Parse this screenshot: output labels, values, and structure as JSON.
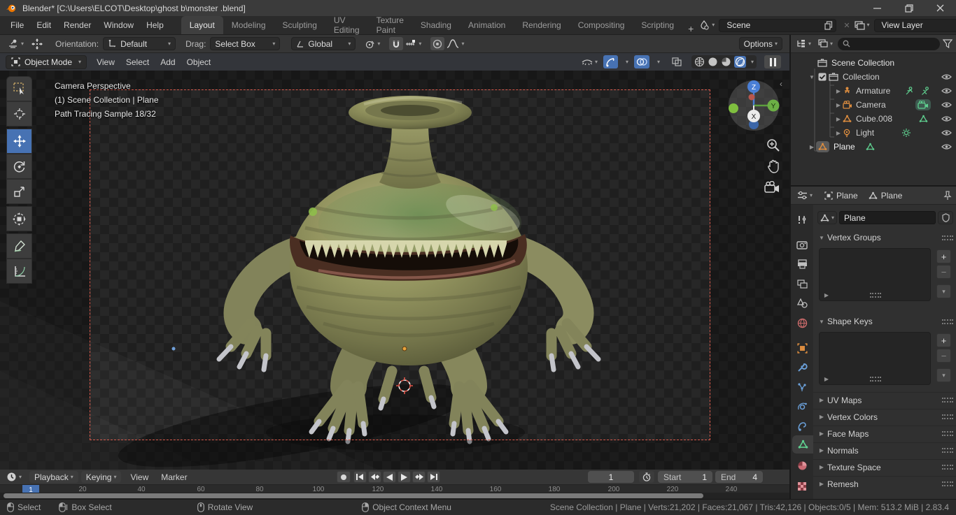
{
  "window": {
    "title": "Blender* [C:\\Users\\ELCOT\\Desktop\\ghost b\\monster .blend]"
  },
  "topbar": {
    "menus": [
      "File",
      "Edit",
      "Render",
      "Window",
      "Help"
    ],
    "workspaces": [
      "Layout",
      "Modeling",
      "Sculpting",
      "UV Editing",
      "Texture Paint",
      "Shading",
      "Animation",
      "Rendering",
      "Compositing",
      "Scripting"
    ],
    "add_tab": "+",
    "scene_label": "Scene",
    "view_layer_label": "View Layer"
  },
  "tool_settings": {
    "orientation_label": "Orientation:",
    "orientation_value": "Default",
    "drag_label": "Drag:",
    "drag_value": "Select Box",
    "pivot_value": "Global",
    "options": "Options"
  },
  "viewport_header": {
    "mode": "Object Mode",
    "menus": [
      "View",
      "Select",
      "Add",
      "Object"
    ]
  },
  "viewport": {
    "overlay_line1": "Camera Perspective",
    "overlay_line2": "(1) Scene Collection | Plane",
    "overlay_line3": "Path Tracing Sample 18/32",
    "axis_x": "X",
    "axis_y": "Y",
    "axis_z": "Z"
  },
  "outliner": {
    "rows": [
      {
        "label": "Scene Collection"
      },
      {
        "label": "Collection"
      },
      {
        "label": "Armature"
      },
      {
        "label": "Camera"
      },
      {
        "label": "Cube.008"
      },
      {
        "label": "Light"
      },
      {
        "label": "Plane"
      }
    ]
  },
  "properties": {
    "breadcrumb_object": "Plane",
    "breadcrumb_data": "Plane",
    "name_value": "Plane",
    "panels": {
      "vertex_groups": "Vertex Groups",
      "shape_keys": "Shape Keys",
      "uv_maps": "UV Maps",
      "vertex_colors": "Vertex Colors",
      "face_maps": "Face Maps",
      "normals": "Normals",
      "texture_space": "Texture Space",
      "remesh": "Remesh"
    }
  },
  "timeline": {
    "playback": "Playback",
    "keying": "Keying",
    "view": "View",
    "marker": "Marker",
    "marker_frame": "1",
    "current_frame": "1",
    "start_label": "Start",
    "start_value": "1",
    "end_label": "End",
    "end_value": "4",
    "ruler": [
      "20",
      "40",
      "60",
      "80",
      "100",
      "120",
      "140",
      "160",
      "180",
      "200",
      "220",
      "240"
    ]
  },
  "statusbar": {
    "hint_select": "Select",
    "hint_box_select": "Box Select",
    "hint_rotate": "Rotate View",
    "hint_context": "Object Context Menu",
    "stats": "Scene Collection | Plane | Verts:21,202 | Faces:21,067 | Tris:42,126 | Objects:0/5 | Mem: 513.2 MiB | 2.83.4"
  },
  "colors": {
    "accent_blue": "#4772b3",
    "object_orange": "#dd8d3f",
    "data_green": "#5fcf8f",
    "camera_border": "#d85a4c"
  }
}
